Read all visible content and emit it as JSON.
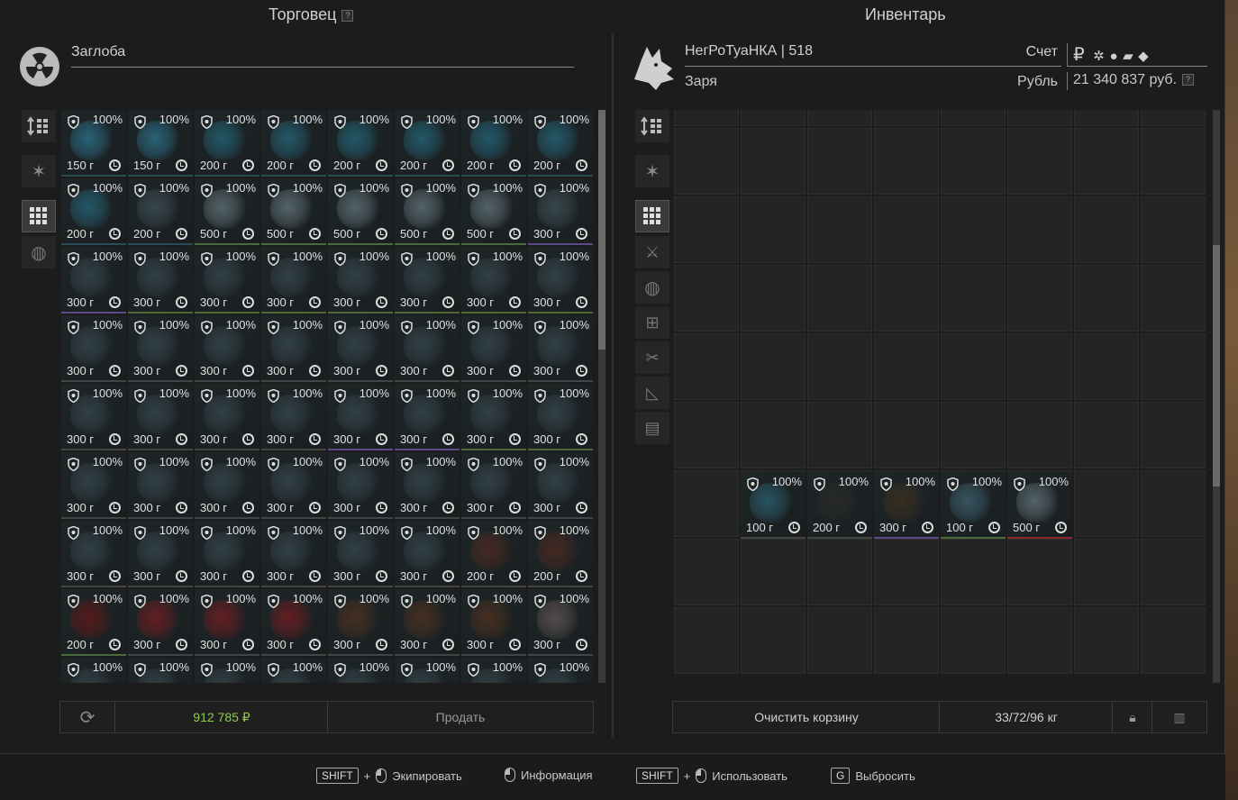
{
  "trader": {
    "title": "Торговец",
    "help": "?",
    "name": "Заглоба",
    "total": "912 785 ₽",
    "sell_label": "Продать"
  },
  "inventory": {
    "title": "Инвентарь",
    "player": "НегРоТуаНКА | 518",
    "faction": "Заря",
    "account_label": "Счет",
    "currency_label": "Рубль",
    "ruble_sign": "₽",
    "balance": "21 340 837 руб.",
    "help": "?",
    "clear_label": "Очистить корзину",
    "weight": "33/72/96 кг"
  },
  "trader_items": [
    [
      "100%",
      "150 г",
      "#2a6a80",
      "#2a4a55"
    ],
    [
      "100%",
      "150 г",
      "#2a6a80",
      "#2a4a55"
    ],
    [
      "100%",
      "200 г",
      "#245e70",
      "#2a4a55"
    ],
    [
      "100%",
      "200 г",
      "#245e70",
      "#2a4a55"
    ],
    [
      "100%",
      "200 г",
      "#245e70",
      "#2a4a55"
    ],
    [
      "100%",
      "200 г",
      "#245e70",
      "#2a4a55"
    ],
    [
      "100%",
      "200 г",
      "#245e70",
      "#2a4a55"
    ],
    [
      "100%",
      "200 г",
      "#245e70",
      "#2a4a55"
    ],
    [
      "100%",
      "200 г",
      "#245e70",
      "#2a4a55"
    ],
    [
      "100%",
      "200 г",
      "#3a4a50",
      "#2a4a55"
    ],
    [
      "100%",
      "500 г",
      "#5a6a70",
      "#4a6a3a"
    ],
    [
      "100%",
      "500 г",
      "#5a6a70",
      "#4a6a3a"
    ],
    [
      "100%",
      "500 г",
      "#5a6a70",
      "#4a6a3a"
    ],
    [
      "100%",
      "500 г",
      "#5a6a70",
      "#4a6a3a"
    ],
    [
      "100%",
      "500 г",
      "#5a6a70",
      "#4a6a3a"
    ],
    [
      "100%",
      "300 г",
      "#3a4a50",
      "#5a4a8a"
    ],
    [
      "100%",
      "300 г",
      "#33434a",
      "#5a4a8a"
    ],
    [
      "100%",
      "300 г",
      "#33434a",
      "#4a6a3a"
    ],
    [
      "100%",
      "300 г",
      "#33434a",
      "#4a6a3a"
    ],
    [
      "100%",
      "300 г",
      "#33434a",
      "#4a6a3a"
    ],
    [
      "100%",
      "300 г",
      "#33434a",
      "#4a6a3a"
    ],
    [
      "100%",
      "300 г",
      "#33434a",
      "#4a6a3a"
    ],
    [
      "100%",
      "300 г",
      "#33434a",
      "#4a6a3a"
    ],
    [
      "100%",
      "300 г",
      "#33434a",
      "#4a6a3a"
    ],
    [
      "100%",
      "300 г",
      "#33434a",
      "#444"
    ],
    [
      "100%",
      "300 г",
      "#33434a",
      "#444"
    ],
    [
      "100%",
      "300 г",
      "#33434a",
      "#444"
    ],
    [
      "100%",
      "300 г",
      "#33434a",
      "#444"
    ],
    [
      "100%",
      "300 г",
      "#33434a",
      "#444"
    ],
    [
      "100%",
      "300 г",
      "#33434a",
      "#444"
    ],
    [
      "100%",
      "300 г",
      "#33434a",
      "#444"
    ],
    [
      "100%",
      "300 г",
      "#33434a",
      "#444"
    ],
    [
      "100%",
      "300 г",
      "#33434a",
      "#444"
    ],
    [
      "100%",
      "300 г",
      "#33434a",
      "#444"
    ],
    [
      "100%",
      "300 г",
      "#33434a",
      "#444"
    ],
    [
      "100%",
      "300 г",
      "#33434a",
      "#444"
    ],
    [
      "100%",
      "300 г",
      "#33434a",
      "#5a4a8a"
    ],
    [
      "100%",
      "300 г",
      "#33434a",
      "#5a4a8a"
    ],
    [
      "100%",
      "300 г",
      "#33434a",
      "#4a6a3a"
    ],
    [
      "100%",
      "300 г",
      "#33434a",
      "#4a6a3a"
    ],
    [
      "100%",
      "300 г",
      "#33434a",
      "#444"
    ],
    [
      "100%",
      "300 г",
      "#33434a",
      "#444"
    ],
    [
      "100%",
      "300 г",
      "#33434a",
      "#444"
    ],
    [
      "100%",
      "300 г",
      "#33434a",
      "#444"
    ],
    [
      "100%",
      "300 г",
      "#33434a",
      "#444"
    ],
    [
      "100%",
      "300 г",
      "#33434a",
      "#444"
    ],
    [
      "100%",
      "300 г",
      "#33434a",
      "#444"
    ],
    [
      "100%",
      "300 г",
      "#33434a",
      "#444"
    ],
    [
      "100%",
      "300 г",
      "#33434a",
      "#444"
    ],
    [
      "100%",
      "300 г",
      "#33434a",
      "#444"
    ],
    [
      "100%",
      "300 г",
      "#33434a",
      "#444"
    ],
    [
      "100%",
      "300 г",
      "#33434a",
      "#444"
    ],
    [
      "100%",
      "300 г",
      "#33434a",
      "#444"
    ],
    [
      "100%",
      "300 г",
      "#33434a",
      "#444"
    ],
    [
      "100%",
      "200 г",
      "#4a2a22",
      "#444"
    ],
    [
      "100%",
      "200 г",
      "#4a2a22",
      "#444"
    ],
    [
      "100%",
      "200 г",
      "#5a1a1a",
      "#4a6a3a"
    ],
    [
      "100%",
      "300 г",
      "#6a1e22",
      "#444"
    ],
    [
      "100%",
      "300 г",
      "#6a1e22",
      "#444"
    ],
    [
      "100%",
      "300 г",
      "#6a1e22",
      "#444"
    ],
    [
      "100%",
      "300 г",
      "#4a3020",
      "#444"
    ],
    [
      "100%",
      "300 г",
      "#4a3020",
      "#444"
    ],
    [
      "100%",
      "300 г",
      "#4a3020",
      "#444"
    ],
    [
      "100%",
      "300 г",
      "#5a5050",
      "#444"
    ],
    [
      "100%",
      "",
      "#33434a",
      "#444"
    ],
    [
      "100%",
      "",
      "#33434a",
      "#444"
    ],
    [
      "100%",
      "",
      "#33434a",
      "#444"
    ],
    [
      "100%",
      "",
      "#33434a",
      "#444"
    ],
    [
      "100%",
      "",
      "#33434a",
      "#444"
    ],
    [
      "100%",
      "",
      "#33434a",
      "#444"
    ],
    [
      "100%",
      "",
      "#33434a",
      "#444"
    ],
    [
      "100%",
      "",
      "#33434a",
      "#444"
    ]
  ],
  "inventory_items": [
    [
      "100%",
      "100 г",
      "#2a5a68",
      "#444"
    ],
    [
      "100%",
      "200 г",
      "#2a2a2a",
      "#444"
    ],
    [
      "100%",
      "300 г",
      "#3a3020",
      "#5a4a8a"
    ],
    [
      "100%",
      "100 г",
      "#3a5a68",
      "#4a6a3a"
    ],
    [
      "100%",
      "500 г",
      "#5a6a70",
      "#8a2a2a"
    ]
  ],
  "hints": [
    {
      "key": "SHIFT",
      "plus": "+",
      "label": "Экипировать"
    },
    {
      "label": "Информация"
    },
    {
      "key": "SHIFT",
      "plus": "+",
      "label": "Использовать"
    },
    {
      "key": "G",
      "label": "Выбросить"
    }
  ]
}
